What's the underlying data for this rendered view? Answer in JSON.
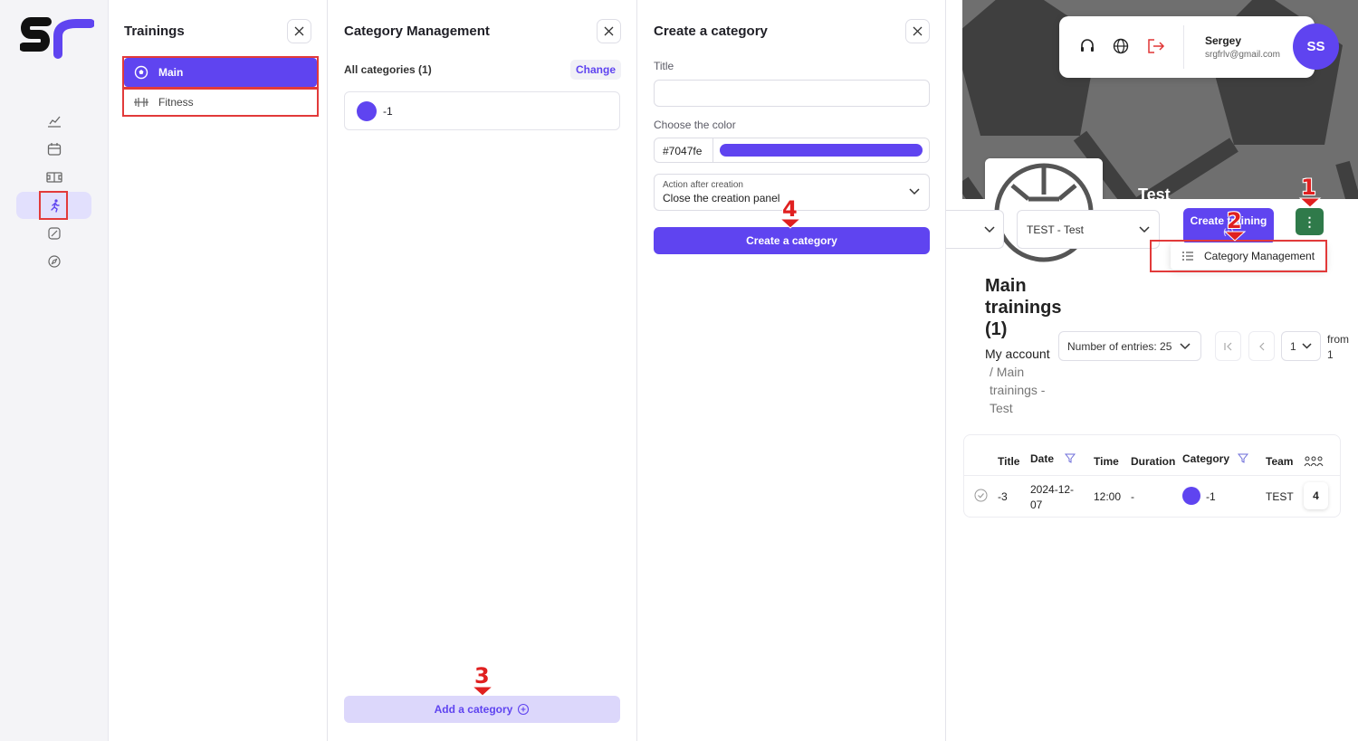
{
  "app": {
    "logo_text": "Sr"
  },
  "trainings_panel": {
    "title": "Trainings",
    "items": [
      {
        "label": "Main",
        "icon": "soccer-ball-icon",
        "active": true
      },
      {
        "label": "Fitness",
        "icon": "dumbbell-icon",
        "active": false
      }
    ]
  },
  "category_panel": {
    "title": "Category Management",
    "list_header": "All categories (1)",
    "change_label": "Change",
    "categories": [
      {
        "name": "-1",
        "color": "#5f44f0"
      }
    ],
    "add_label": "Add a category"
  },
  "create_panel": {
    "title": "Create a category",
    "title_label": "Title",
    "title_value": "",
    "color_label": "Choose the color",
    "color_hex": "#7047fe",
    "action_label": "Action after creation",
    "action_value": "Close the creation panel",
    "submit_label": "Create a category"
  },
  "user": {
    "name": "Sergey",
    "email": "srgfrlv@gmail.com",
    "initials": "SS"
  },
  "team_header": {
    "hero_text": "Test"
  },
  "toolbar": {
    "team_select": "TEST - Test",
    "create_training_label": "Create training",
    "create_training_sub": "(+)",
    "more_label": "⋮",
    "menu_item": "Category Management"
  },
  "page": {
    "title": "Main trainings (1)",
    "breadcrumb_root": "My account",
    "breadcrumb_rest": "/ Main trainings - Test",
    "entries_label": "Number of entries: 25",
    "page_number": "1",
    "from_label": "from",
    "from_total": "1"
  },
  "table": {
    "headers": {
      "title": "Title",
      "date": "Date",
      "time": "Time",
      "duration": "Duration",
      "category": "Category",
      "team": "Team"
    },
    "rows": [
      {
        "title": "-3",
        "date": "2024-12-07",
        "time": "12:00",
        "duration": "-",
        "category": "-1",
        "team": "TEST",
        "count": "4"
      }
    ]
  },
  "annotations": [
    "1",
    "2",
    "3",
    "4"
  ],
  "colors": {
    "accent": "#5f44f0",
    "highlight": "#e23a3a",
    "green": "#2f7a4a"
  }
}
